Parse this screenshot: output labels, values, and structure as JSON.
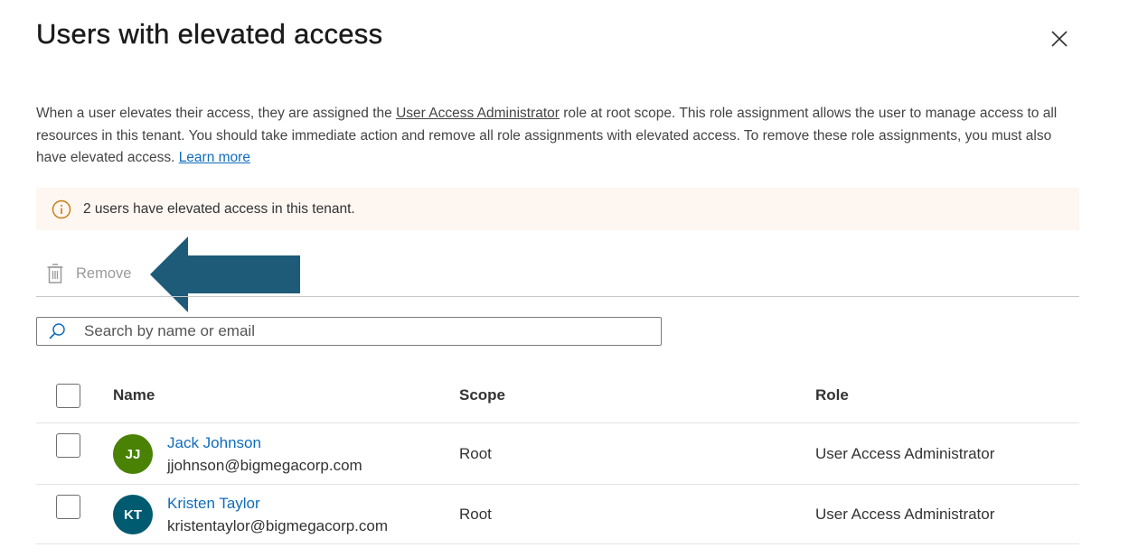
{
  "dialog": {
    "title": "Users with elevated access",
    "close_icon": "close-icon"
  },
  "description": {
    "part1": "When a user elevates their access, they are assigned the ",
    "role_link": "User Access Administrator",
    "part2": " role at root scope. This role assignment allows the user to manage access to all resources in this tenant. You should take immediate action and remove all role assignments with elevated access. To remove these role assignments, you must also have elevated access. ",
    "learn_more": "Learn more"
  },
  "banner": {
    "icon": "info-icon",
    "text": "2 users have elevated access in this tenant."
  },
  "toolbar": {
    "remove_label": "Remove",
    "remove_icon": "trash-icon"
  },
  "search": {
    "placeholder": "Search by name or email",
    "icon": "search-icon"
  },
  "table": {
    "headers": {
      "name": "Name",
      "scope": "Scope",
      "role": "Role"
    },
    "rows": [
      {
        "initials": "JJ",
        "name": "Jack Johnson",
        "email": "jjohnson@bigmegacorp.com",
        "scope": "Root",
        "role": "User Access Administrator",
        "avatar_color": "#498205"
      },
      {
        "initials": "KT",
        "name": "Kristen Taylor",
        "email": "kristentaylor@bigmegacorp.com",
        "scope": "Root",
        "role": "User Access Administrator",
        "avatar_color": "#005b70"
      }
    ]
  },
  "colors": {
    "accent": "#0f6cbd",
    "banner_bg": "#fdf6f1",
    "warning": "#c87a12",
    "annotation_arrow": "#1d5b78"
  }
}
